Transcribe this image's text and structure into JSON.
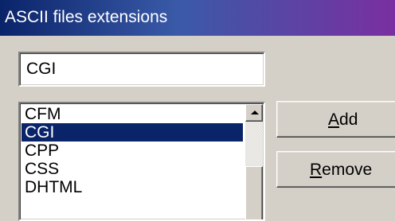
{
  "window": {
    "title": "ASCII files extensions"
  },
  "extension_field": {
    "value": "CGI"
  },
  "extensions_list": {
    "items": [
      "CFM",
      "CGI",
      "CPP",
      "CSS",
      "DHTML"
    ],
    "selected": "CGI"
  },
  "buttons": {
    "add": {
      "mnemonic": "A",
      "rest": "dd"
    },
    "remove": {
      "mnemonic": "R",
      "rest": "emove"
    }
  },
  "colors": {
    "selection": "#0a246a",
    "face": "#d4d0c8"
  }
}
